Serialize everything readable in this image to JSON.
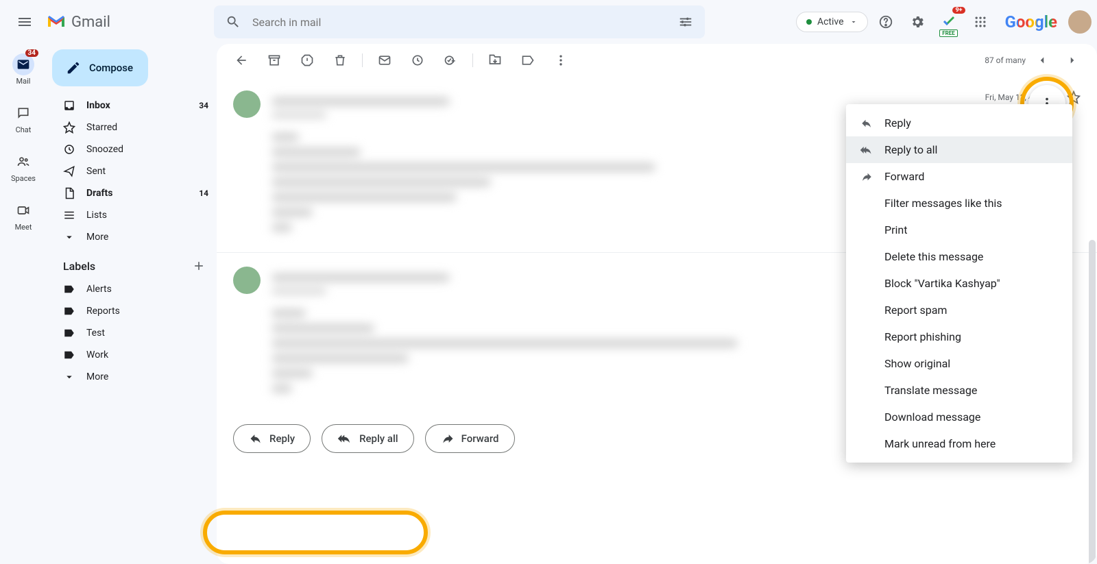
{
  "header": {
    "product": "Gmail",
    "search_placeholder": "Search in mail",
    "status": "Active",
    "notif_badge": "9+",
    "free_tag": "FREE",
    "google": "Google"
  },
  "rail": {
    "items": [
      {
        "label": "Mail",
        "badge": "34"
      },
      {
        "label": "Chat"
      },
      {
        "label": "Spaces"
      },
      {
        "label": "Meet"
      }
    ]
  },
  "sidebar": {
    "compose": "Compose",
    "nav": [
      {
        "label": "Inbox",
        "count": "34",
        "bold": true
      },
      {
        "label": "Starred"
      },
      {
        "label": "Snoozed"
      },
      {
        "label": "Sent"
      },
      {
        "label": "Drafts",
        "count": "14",
        "bold": true
      },
      {
        "label": "Lists"
      },
      {
        "label": "More"
      }
    ],
    "labels_header": "Labels",
    "labels": [
      {
        "label": "Alerts"
      },
      {
        "label": "Reports"
      },
      {
        "label": "Test"
      },
      {
        "label": "Work"
      },
      {
        "label": "More"
      }
    ]
  },
  "toolbar": {
    "position": "87 of many"
  },
  "messages": [
    {
      "date": "Fri, May 13, 4:32 PM"
    }
  ],
  "reply_bar": {
    "reply": "Reply",
    "reply_all": "Reply all",
    "forward": "Forward"
  },
  "context_menu": {
    "items": [
      {
        "label": "Reply",
        "icon": "reply"
      },
      {
        "label": "Reply to all",
        "icon": "reply-all",
        "hover": true
      },
      {
        "label": "Forward",
        "icon": "forward"
      },
      {
        "label": "Filter messages like this"
      },
      {
        "label": "Print"
      },
      {
        "label": "Delete this message"
      },
      {
        "label": "Block \"Vartika Kashyap\""
      },
      {
        "label": "Report spam"
      },
      {
        "label": "Report phishing"
      },
      {
        "label": "Show original"
      },
      {
        "label": "Translate message"
      },
      {
        "label": "Download message"
      },
      {
        "label": "Mark unread from here"
      }
    ]
  }
}
